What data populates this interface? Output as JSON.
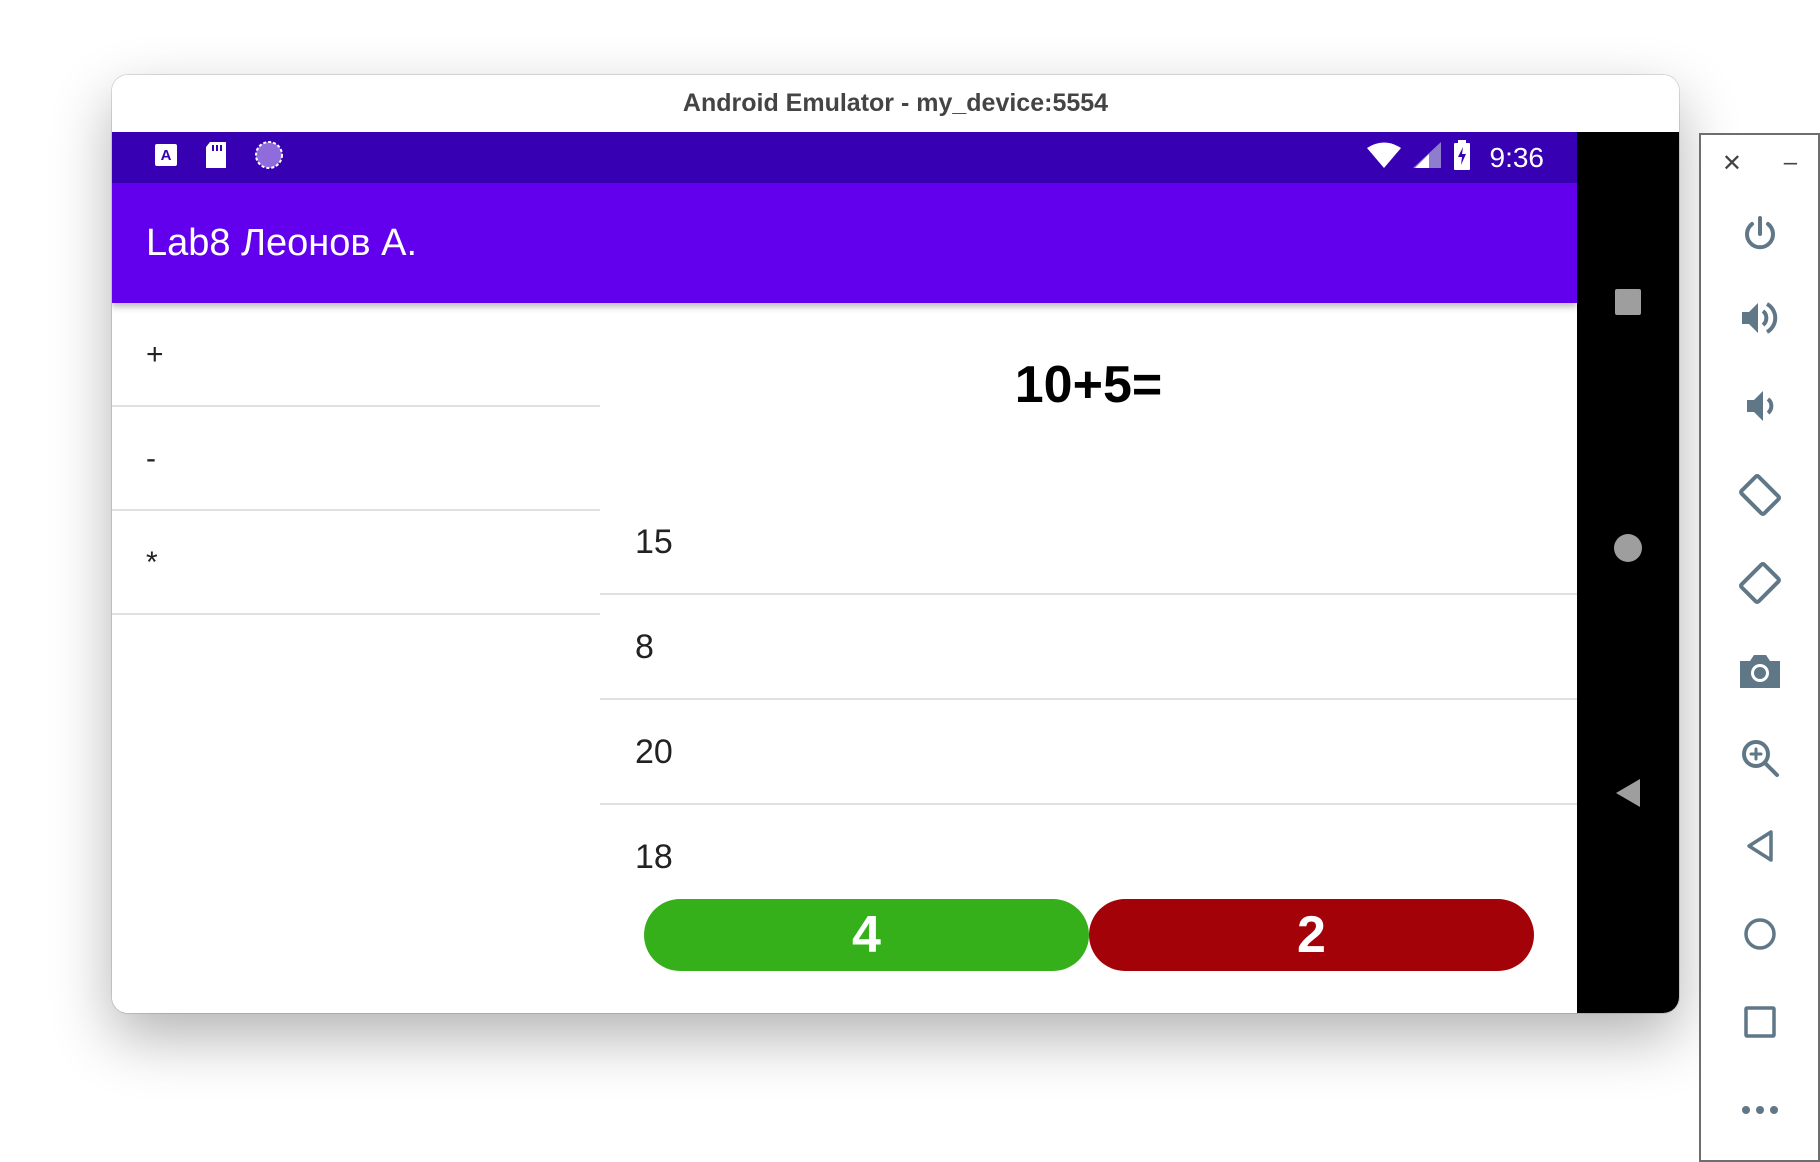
{
  "window": {
    "title": "Android Emulator - my_device:5554"
  },
  "status_bar": {
    "time": "9:36",
    "left_icons": [
      "app-notification-icon",
      "sd-card-icon",
      "loading-spinner-icon"
    ],
    "right_icons": [
      "wifi-icon",
      "signal-icon",
      "battery-charging-icon"
    ]
  },
  "app_bar": {
    "title": "Lab8 Леонов А."
  },
  "operations": [
    {
      "label": "+"
    },
    {
      "label": "-"
    },
    {
      "label": "*"
    }
  ],
  "question": "10+5=",
  "answers": [
    {
      "label": "15"
    },
    {
      "label": "8"
    },
    {
      "label": "20"
    },
    {
      "label": "18"
    }
  ],
  "score": {
    "correct": "4",
    "wrong": "2"
  },
  "colors": {
    "status_bar": "#3700b3",
    "app_bar": "#6200ee",
    "correct": "#35b01a",
    "wrong": "#a30208",
    "panel_icon": "#5f7786"
  },
  "nav_buttons": [
    "recents-icon",
    "home-icon",
    "back-icon"
  ],
  "emulator_tools": {
    "window_controls": [
      "close-icon",
      "minimize-icon"
    ],
    "tools": [
      "power-icon",
      "volume-up-icon",
      "volume-down-icon",
      "rotate-left-icon",
      "rotate-right-icon",
      "camera-icon",
      "zoom-icon",
      "back-icon",
      "home-icon",
      "overview-icon",
      "more-icon"
    ]
  }
}
